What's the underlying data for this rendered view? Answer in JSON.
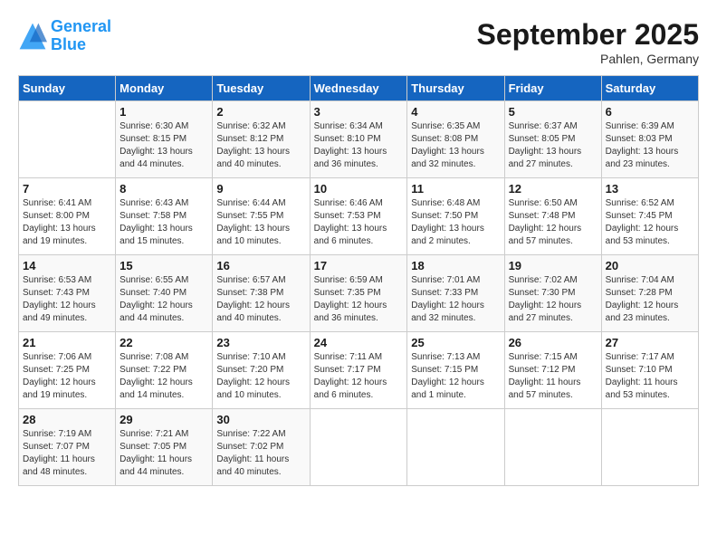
{
  "header": {
    "logo_line1": "General",
    "logo_line2": "Blue",
    "month_title": "September 2025",
    "subtitle": "Pahlen, Germany"
  },
  "days_of_week": [
    "Sunday",
    "Monday",
    "Tuesday",
    "Wednesday",
    "Thursday",
    "Friday",
    "Saturday"
  ],
  "weeks": [
    [
      {
        "day": "",
        "info": ""
      },
      {
        "day": "1",
        "info": "Sunrise: 6:30 AM\nSunset: 8:15 PM\nDaylight: 13 hours\nand 44 minutes."
      },
      {
        "day": "2",
        "info": "Sunrise: 6:32 AM\nSunset: 8:12 PM\nDaylight: 13 hours\nand 40 minutes."
      },
      {
        "day": "3",
        "info": "Sunrise: 6:34 AM\nSunset: 8:10 PM\nDaylight: 13 hours\nand 36 minutes."
      },
      {
        "day": "4",
        "info": "Sunrise: 6:35 AM\nSunset: 8:08 PM\nDaylight: 13 hours\nand 32 minutes."
      },
      {
        "day": "5",
        "info": "Sunrise: 6:37 AM\nSunset: 8:05 PM\nDaylight: 13 hours\nand 27 minutes."
      },
      {
        "day": "6",
        "info": "Sunrise: 6:39 AM\nSunset: 8:03 PM\nDaylight: 13 hours\nand 23 minutes."
      }
    ],
    [
      {
        "day": "7",
        "info": "Sunrise: 6:41 AM\nSunset: 8:00 PM\nDaylight: 13 hours\nand 19 minutes."
      },
      {
        "day": "8",
        "info": "Sunrise: 6:43 AM\nSunset: 7:58 PM\nDaylight: 13 hours\nand 15 minutes."
      },
      {
        "day": "9",
        "info": "Sunrise: 6:44 AM\nSunset: 7:55 PM\nDaylight: 13 hours\nand 10 minutes."
      },
      {
        "day": "10",
        "info": "Sunrise: 6:46 AM\nSunset: 7:53 PM\nDaylight: 13 hours\nand 6 minutes."
      },
      {
        "day": "11",
        "info": "Sunrise: 6:48 AM\nSunset: 7:50 PM\nDaylight: 13 hours\nand 2 minutes."
      },
      {
        "day": "12",
        "info": "Sunrise: 6:50 AM\nSunset: 7:48 PM\nDaylight: 12 hours\nand 57 minutes."
      },
      {
        "day": "13",
        "info": "Sunrise: 6:52 AM\nSunset: 7:45 PM\nDaylight: 12 hours\nand 53 minutes."
      }
    ],
    [
      {
        "day": "14",
        "info": "Sunrise: 6:53 AM\nSunset: 7:43 PM\nDaylight: 12 hours\nand 49 minutes."
      },
      {
        "day": "15",
        "info": "Sunrise: 6:55 AM\nSunset: 7:40 PM\nDaylight: 12 hours\nand 44 minutes."
      },
      {
        "day": "16",
        "info": "Sunrise: 6:57 AM\nSunset: 7:38 PM\nDaylight: 12 hours\nand 40 minutes."
      },
      {
        "day": "17",
        "info": "Sunrise: 6:59 AM\nSunset: 7:35 PM\nDaylight: 12 hours\nand 36 minutes."
      },
      {
        "day": "18",
        "info": "Sunrise: 7:01 AM\nSunset: 7:33 PM\nDaylight: 12 hours\nand 32 minutes."
      },
      {
        "day": "19",
        "info": "Sunrise: 7:02 AM\nSunset: 7:30 PM\nDaylight: 12 hours\nand 27 minutes."
      },
      {
        "day": "20",
        "info": "Sunrise: 7:04 AM\nSunset: 7:28 PM\nDaylight: 12 hours\nand 23 minutes."
      }
    ],
    [
      {
        "day": "21",
        "info": "Sunrise: 7:06 AM\nSunset: 7:25 PM\nDaylight: 12 hours\nand 19 minutes."
      },
      {
        "day": "22",
        "info": "Sunrise: 7:08 AM\nSunset: 7:22 PM\nDaylight: 12 hours\nand 14 minutes."
      },
      {
        "day": "23",
        "info": "Sunrise: 7:10 AM\nSunset: 7:20 PM\nDaylight: 12 hours\nand 10 minutes."
      },
      {
        "day": "24",
        "info": "Sunrise: 7:11 AM\nSunset: 7:17 PM\nDaylight: 12 hours\nand 6 minutes."
      },
      {
        "day": "25",
        "info": "Sunrise: 7:13 AM\nSunset: 7:15 PM\nDaylight: 12 hours\nand 1 minute."
      },
      {
        "day": "26",
        "info": "Sunrise: 7:15 AM\nSunset: 7:12 PM\nDaylight: 11 hours\nand 57 minutes."
      },
      {
        "day": "27",
        "info": "Sunrise: 7:17 AM\nSunset: 7:10 PM\nDaylight: 11 hours\nand 53 minutes."
      }
    ],
    [
      {
        "day": "28",
        "info": "Sunrise: 7:19 AM\nSunset: 7:07 PM\nDaylight: 11 hours\nand 48 minutes."
      },
      {
        "day": "29",
        "info": "Sunrise: 7:21 AM\nSunset: 7:05 PM\nDaylight: 11 hours\nand 44 minutes."
      },
      {
        "day": "30",
        "info": "Sunrise: 7:22 AM\nSunset: 7:02 PM\nDaylight: 11 hours\nand 40 minutes."
      },
      {
        "day": "",
        "info": ""
      },
      {
        "day": "",
        "info": ""
      },
      {
        "day": "",
        "info": ""
      },
      {
        "day": "",
        "info": ""
      }
    ]
  ]
}
